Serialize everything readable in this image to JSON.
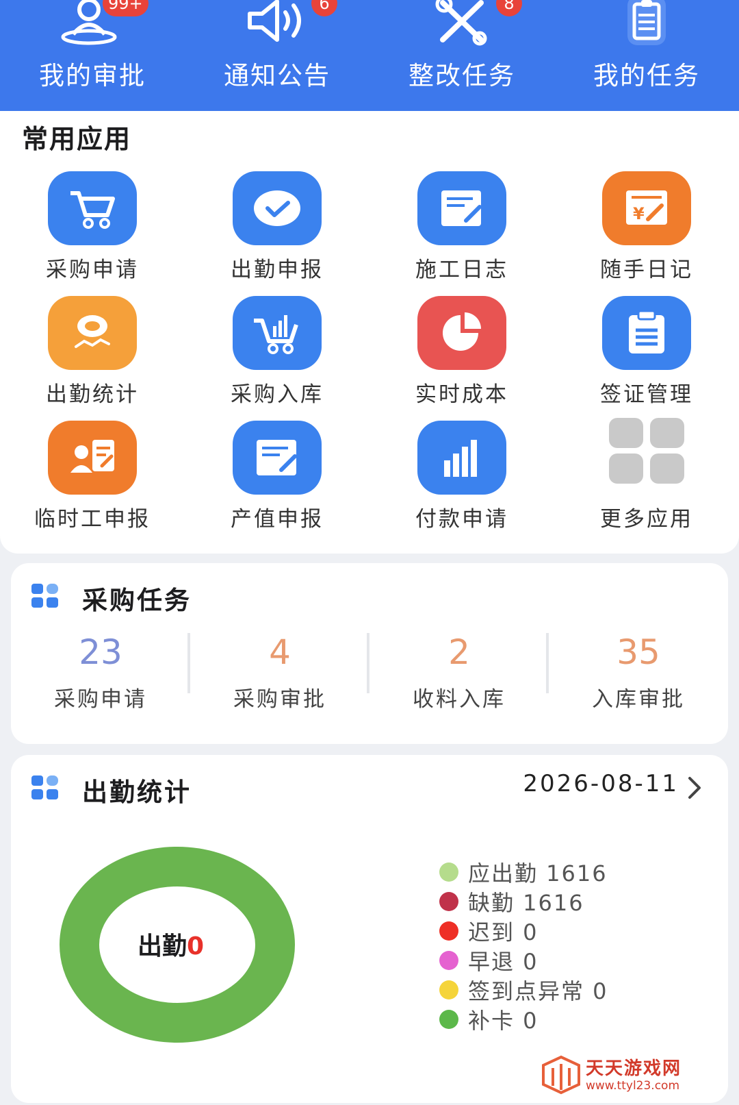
{
  "top_nav": [
    {
      "label": "我的审批",
      "icon": "approval-person-icon",
      "badge": "99+"
    },
    {
      "label": "通知公告",
      "icon": "speaker-icon",
      "badge": "6"
    },
    {
      "label": "整改任务",
      "icon": "tools-icon",
      "badge": "8"
    },
    {
      "label": "我的任务",
      "icon": "clipboard-icon",
      "badge": ""
    }
  ],
  "apps": {
    "title": "常用应用",
    "items": [
      {
        "label": "采购申请",
        "icon": "cart-icon",
        "color": "#3b82ee"
      },
      {
        "label": "出勤申报",
        "icon": "check-bubble-icon",
        "color": "#3b82ee"
      },
      {
        "label": "施工日志",
        "icon": "edit-doc-icon",
        "color": "#3b82ee"
      },
      {
        "label": "随手日记",
        "icon": "yen-note-icon",
        "color": "#f07c2c"
      },
      {
        "label": "出勤统计",
        "icon": "attendance-person-icon",
        "color": "#f5a03a"
      },
      {
        "label": "采购入库",
        "icon": "cart-stock-icon",
        "color": "#3b82ee"
      },
      {
        "label": "实时成本",
        "icon": "pie-icon",
        "color": "#e85452"
      },
      {
        "label": "签证管理",
        "icon": "list-doc-icon",
        "color": "#3b82ee"
      },
      {
        "label": "临时工申报",
        "icon": "worker-card-icon",
        "color": "#f07c2c"
      },
      {
        "label": "产值申报",
        "icon": "edit-report-icon",
        "color": "#3b82ee"
      },
      {
        "label": "付款申请",
        "icon": "bar-chart-icon",
        "color": "#3b82ee"
      },
      {
        "label": "更多应用",
        "icon": "grid-icon",
        "color": "#c9c9c9"
      }
    ]
  },
  "purchase": {
    "title": "采购任务",
    "stats": [
      {
        "value": "23",
        "label": "采购申请",
        "color": "#7e8fd6"
      },
      {
        "value": "4",
        "label": "采购审批",
        "color": "#e89a6f"
      },
      {
        "value": "2",
        "label": "收料入库",
        "color": "#e89a6f"
      },
      {
        "value": "35",
        "label": "入库审批",
        "color": "#e89a6f"
      }
    ]
  },
  "attendance": {
    "title": "出勤统计",
    "date": "2026-08-11",
    "center_label": "出勤",
    "center_value": "0",
    "legend": [
      {
        "label": "应出勤 1616",
        "color": "#b5dc8c"
      },
      {
        "label": "缺勤 1616",
        "color": "#c0324a"
      },
      {
        "label": "迟到 0",
        "color": "#ee2f26"
      },
      {
        "label": "早退 0",
        "color": "#e562d0"
      },
      {
        "label": "签到点异常 0",
        "color": "#f5d43a"
      },
      {
        "label": "补卡 0",
        "color": "#5cb84a"
      }
    ],
    "ring_color": "#6ab54f"
  },
  "watermark": {
    "name": "天天游戏网",
    "url": "www.ttyl23.com"
  }
}
